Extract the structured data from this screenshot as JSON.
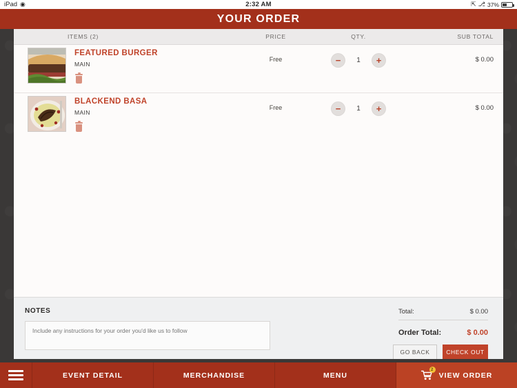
{
  "status_bar": {
    "device": "iPad",
    "wifi_icon": "wifi-icon",
    "time": "2:32 AM",
    "location_icon": "location-arrow-icon",
    "bluetooth_icon": "bluetooth-icon",
    "battery_percent": "37%"
  },
  "header": {
    "title": "YOUR ORDER"
  },
  "table": {
    "columns": {
      "items": "ITEMS (2)",
      "price": "PRICE",
      "qty": "QTY.",
      "subtotal": "SUB TOTAL"
    },
    "rows": [
      {
        "name": "FEATURED BURGER",
        "category": "MAIN",
        "price": "Free",
        "qty": "1",
        "subtotal": "$ 0.00",
        "thumb": "burger-photo",
        "minus": "−",
        "plus": "+"
      },
      {
        "name": "BLACKEND BASA",
        "category": "MAIN",
        "price": "Free",
        "qty": "1",
        "subtotal": "$ 0.00",
        "thumb": "fish-dish-photo",
        "minus": "−",
        "plus": "+"
      }
    ]
  },
  "notes": {
    "label": "NOTES",
    "placeholder": "Include any instructions for your order you'd like us to follow",
    "value": ""
  },
  "totals": {
    "total_label": "Total:",
    "total_value": "$ 0.00",
    "order_total_label": "Order Total:",
    "order_total_value": "$ 0.00",
    "go_back": "GO BACK",
    "check_out": "CHECK OUT"
  },
  "tabbar": {
    "menu_icon": "hamburger-menu-icon",
    "items": [
      {
        "label": "EVENT DETAIL",
        "active": false
      },
      {
        "label": "MERCHANDISE",
        "active": false
      },
      {
        "label": "MENU",
        "active": false
      },
      {
        "label": "VIEW ORDER",
        "active": true
      }
    ],
    "cart_icon": "shopping-cart-icon",
    "cart_badge": "2"
  },
  "colors": {
    "brand_red": "#a3301b",
    "active_red": "#bb4224",
    "accent_orange": "#c0432a",
    "badge_yellow": "#f2c037",
    "dark_frame": "#3a3837",
    "card_bg": "#fdfbfa"
  }
}
